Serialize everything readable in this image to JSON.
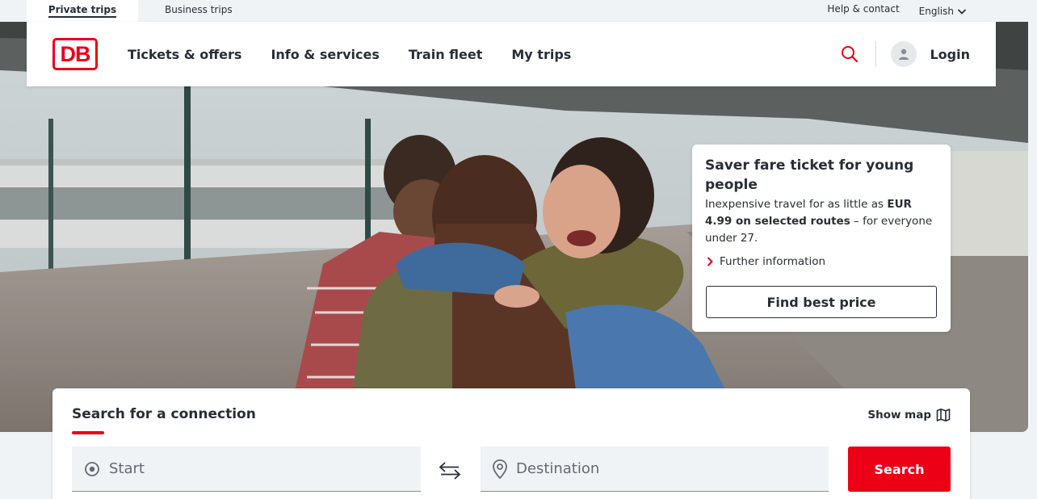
{
  "topbar": {
    "private_trips": "Private trips",
    "business_trips": "Business trips",
    "help_contact": "Help & contact",
    "language": "English"
  },
  "header": {
    "logo_text": "DB",
    "nav": [
      "Tickets & offers",
      "Info & services",
      "Train fleet",
      "My trips"
    ],
    "login": "Login"
  },
  "promo": {
    "title": "Saver fare ticket for young people",
    "text_before": "Inexpensive travel for as little as ",
    "text_bold": "EUR 4.99 on selected routes",
    "text_after": " – for everyone under 27.",
    "further_link": "Further information",
    "button": "Find best price"
  },
  "search": {
    "title": "Search for a connection",
    "show_map": "Show map",
    "start_placeholder": "Start",
    "destination_placeholder": "Destination",
    "button": "Search"
  },
  "colors": {
    "brand_red": "#ec0016",
    "text_dark": "#282d37",
    "field_bg": "#f0f3f5"
  },
  "icons": {
    "language": "chevron-down-icon",
    "search": "magnifier-icon",
    "account": "user-icon",
    "further": "chevron-right-icon",
    "map": "map-icon",
    "start": "target-icon",
    "destination": "map-pin-icon",
    "swap": "swap-arrows-icon"
  }
}
